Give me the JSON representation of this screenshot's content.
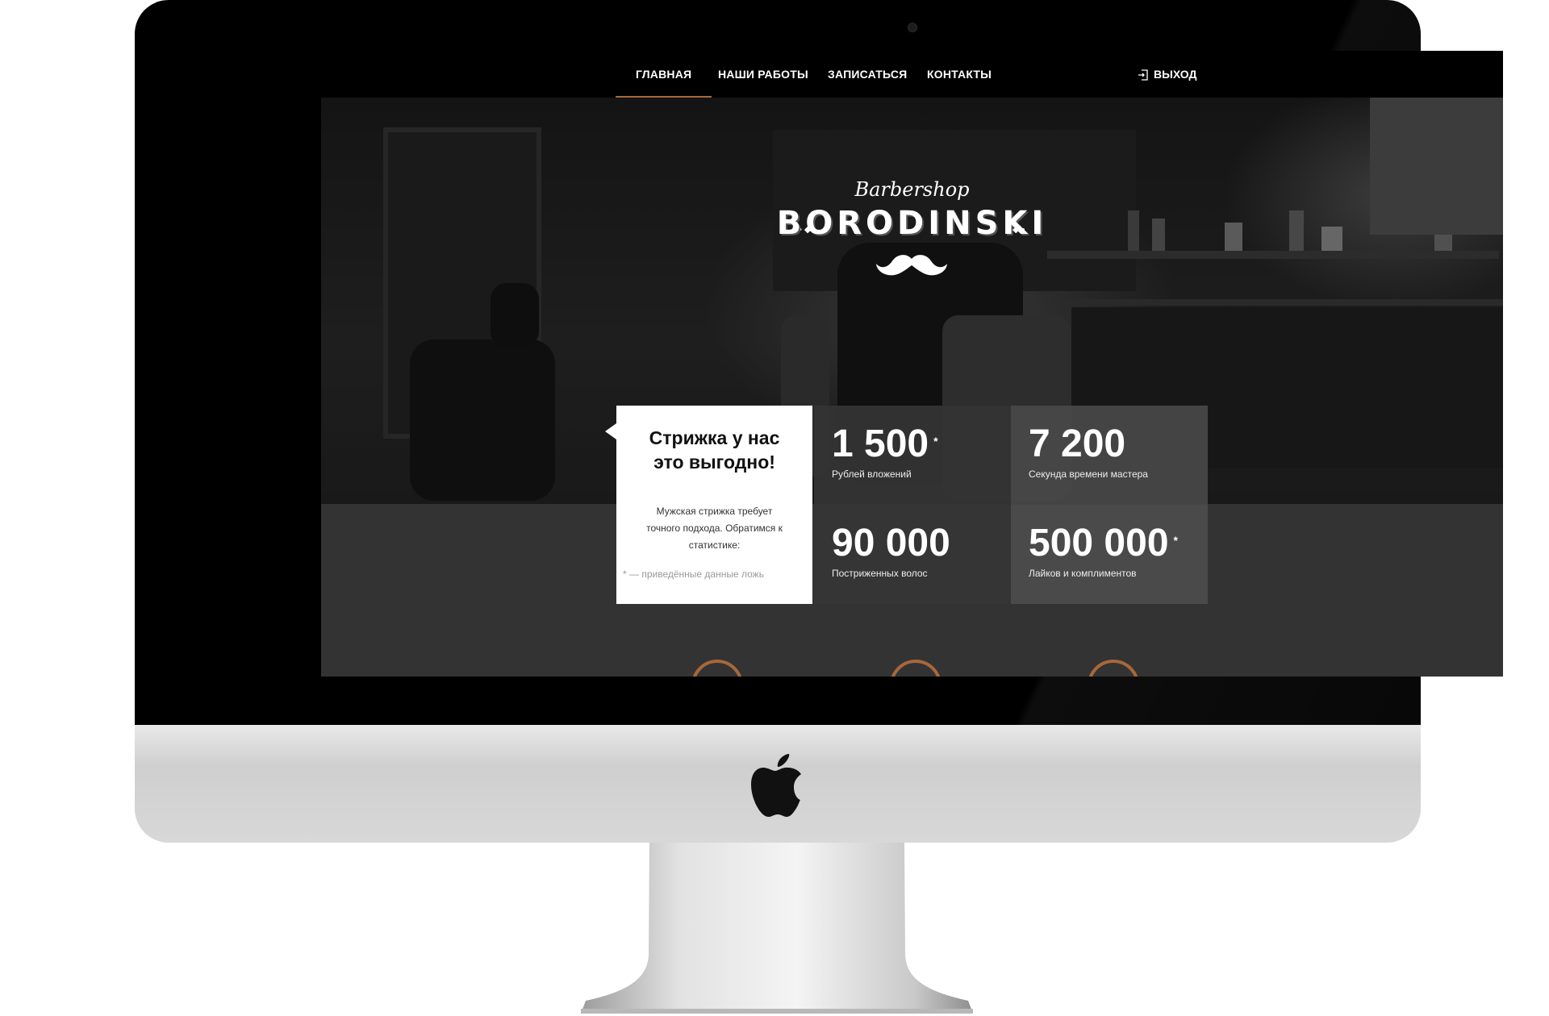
{
  "nav": {
    "items": [
      {
        "label": "ГЛАВНАЯ",
        "active": true
      },
      {
        "label": "НАШИ РАБОТЫ",
        "active": false
      },
      {
        "label": "ЗАПИСАТЬСЯ",
        "active": false
      },
      {
        "label": "КОНТАКТЫ",
        "active": false
      }
    ],
    "logout_label": "ВЫХОД"
  },
  "brand": {
    "script": "Barbershop",
    "name": "BORODINSKI"
  },
  "intro": {
    "title_line1": "Стрижка у нас",
    "title_line2": "это выгодно!",
    "text_line1": "Мужская стрижка требует",
    "text_line2": "точного подхода. Обратимся к",
    "text_line3": "статистике:",
    "note": "* — приведённые данные ложь"
  },
  "stats": [
    {
      "value": "1 500",
      "mark": "*",
      "label": "Рублей вложений"
    },
    {
      "value": "7 200",
      "mark": "",
      "label": "Секунда времени мастера"
    },
    {
      "value": "90 000",
      "mark": "",
      "label": "Постриженных волос"
    },
    {
      "value": "500 000",
      "mark": "*",
      "label": "Лайков и комплиментов"
    }
  ],
  "colors": {
    "accent": "#a7683b",
    "nav_bg": "#000000",
    "page_bg": "#333333"
  },
  "icons": [
    "logout-icon",
    "mustache-icon",
    "apple-logo-icon",
    "service-icon"
  ]
}
